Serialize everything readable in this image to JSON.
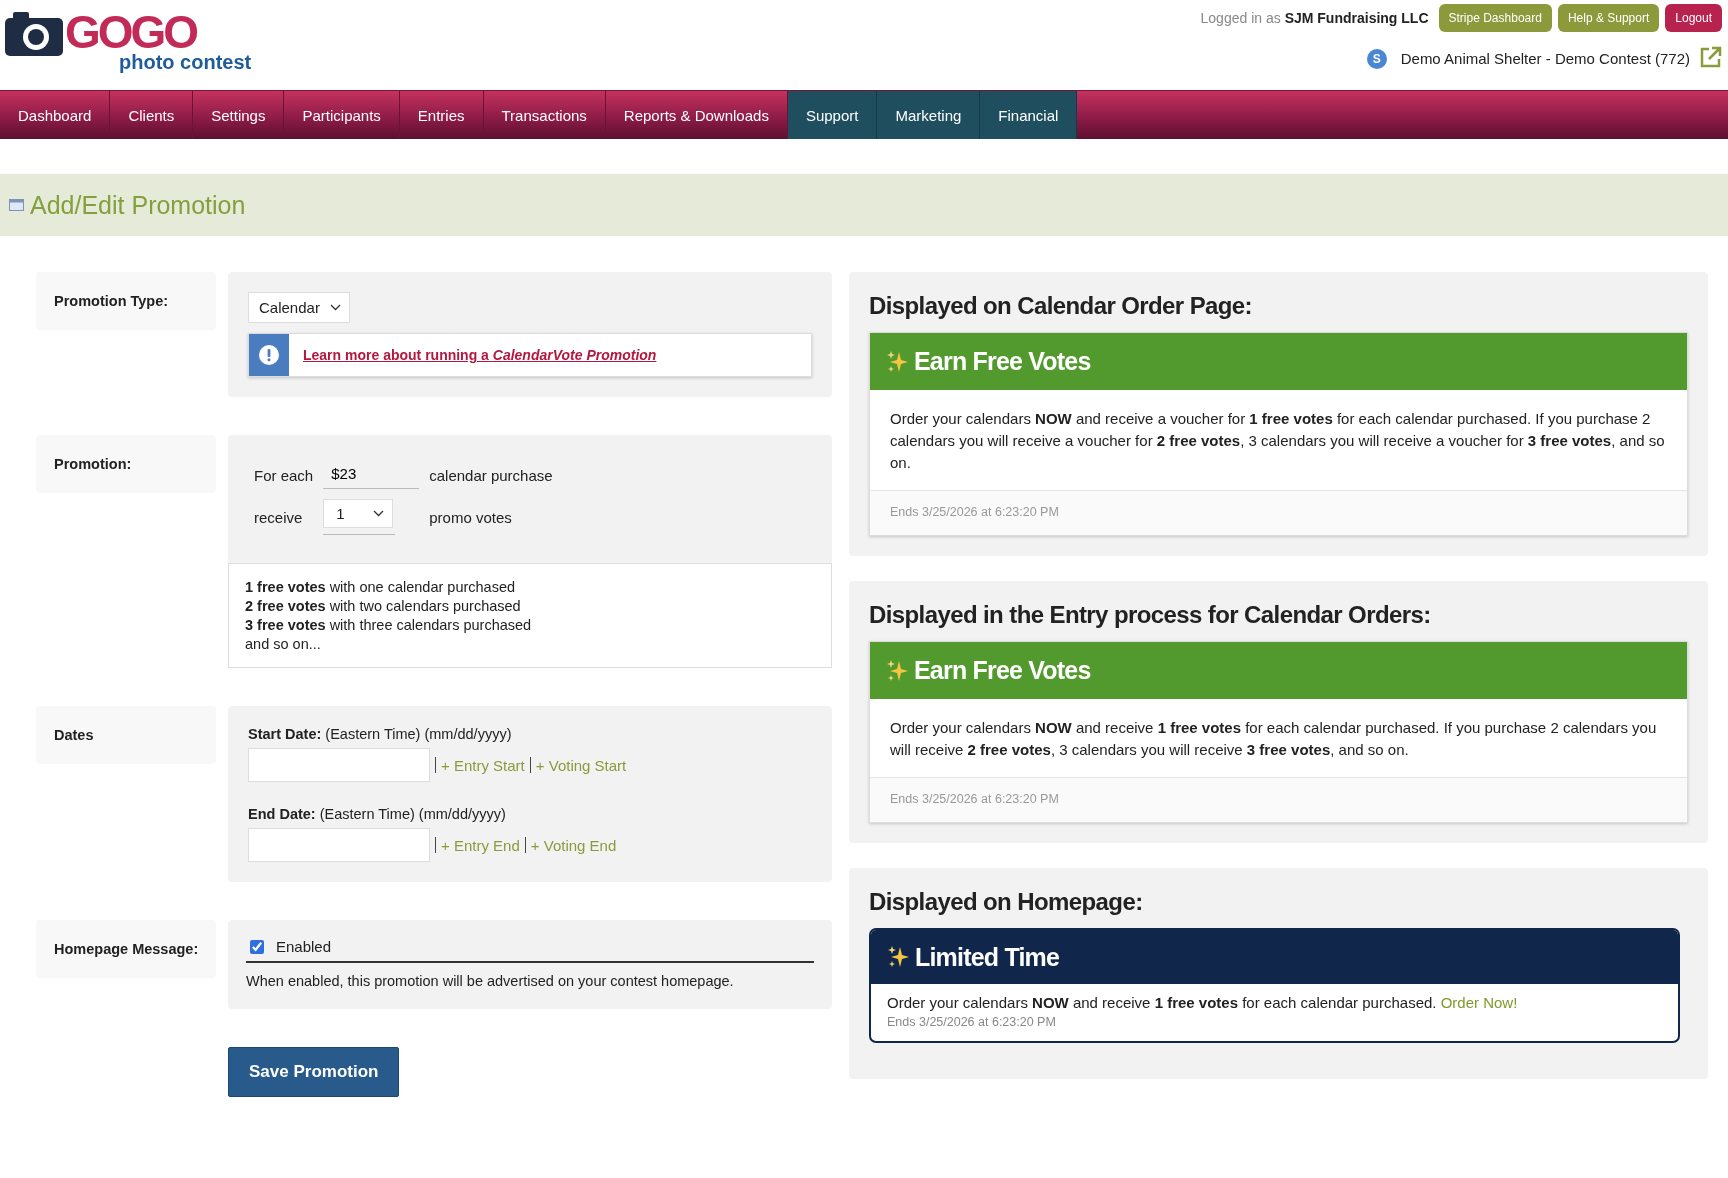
{
  "header": {
    "logo": {
      "word": "GOGO",
      "tagline": "photo contest"
    },
    "account": "Logged in as **SJM Fundraising LLC**",
    "buttons": [
      {
        "label": "Stripe Dashboard",
        "kind": "olive"
      },
      {
        "label": "Help & Support",
        "kind": "olive"
      },
      {
        "label": "Logout",
        "kind": "danger"
      }
    ],
    "contest": {
      "badge": "S",
      "name": "Demo Animal Shelter - Demo Contest (772)"
    }
  },
  "nav": [
    {
      "label": "Dashboard",
      "kind": "main"
    },
    {
      "label": "Clients",
      "kind": "main"
    },
    {
      "label": "Settings",
      "kind": "main"
    },
    {
      "label": "Participants",
      "kind": "main"
    },
    {
      "label": "Entries",
      "kind": "main"
    },
    {
      "label": "Transactions",
      "kind": "main"
    },
    {
      "label": "Reports & Downloads",
      "kind": "main"
    },
    {
      "label": "Support",
      "kind": "extra"
    },
    {
      "label": "Marketing",
      "kind": "extra"
    },
    {
      "label": "Financial",
      "kind": "extra"
    }
  ],
  "page_title": "Add/Edit Promotion",
  "form": {
    "promotion_type": {
      "label": "Promotion Type:",
      "value": "Calendar",
      "info_link": "Learn more about running a *CalendarVote Promotion*"
    },
    "promotion": {
      "label": "Promotion:",
      "for_each": "For each",
      "price": "$23",
      "price_suffix": "calendar purchase",
      "receive": "receive",
      "votes": "1",
      "votes_suffix": "promo votes",
      "examples": [
        "**1 free votes** with one calendar purchased",
        "**2 free votes** with two calendars purchased",
        "**3 free votes** with three calendars purchased",
        "and so on..."
      ]
    },
    "dates": {
      "label": "Dates",
      "fields": [
        {
          "caption": "**Start Date:** (Eastern Time) (mm/dd/yyyy)",
          "links": [
            "+ Entry Start",
            "+ Voting Start"
          ]
        },
        {
          "caption": "**End Date:** (Eastern Time) (mm/dd/yyyy)",
          "links": [
            "+ Entry End",
            "+ Voting End"
          ]
        }
      ]
    },
    "homepage": {
      "label": "Homepage Message:",
      "enabled": true,
      "option": "Enabled",
      "help": "When enabled, this promotion will be advertised on your contest homepage."
    },
    "save_button": "Save Promotion"
  },
  "previews": [
    {
      "heading": "Displayed on Calendar Order Page:",
      "kind": "card",
      "title": "Earn Free Votes",
      "body": "Order your calendars **NOW** and receive a voucher for **1 free votes** for each calendar purchased. If you purchase 2 calendars you will receive a voucher for **2 free votes**, 3 calendars you will receive a voucher for **3 free votes**, and so on.",
      "ends": "Ends 3/25/2026 at 6:23:20 PM"
    },
    {
      "heading": "Displayed in the Entry process for Calendar Orders:",
      "kind": "card",
      "title": "Earn Free Votes",
      "body": "Order your calendars **NOW** and receive **1 free votes** for each calendar purchased. If you purchase 2 calendars you will receive **2 free votes**, 3 calendars you will receive **3 free votes**, and so on.",
      "ends": "Ends 3/25/2026 at 6:23:20 PM"
    },
    {
      "heading": "Displayed on Homepage:",
      "kind": "banner",
      "title": "Limited Time",
      "body": "Order your calendars **NOW** and receive **1 free votes** for each calendar purchased.",
      "link": "Order Now!",
      "ends": "Ends 3/25/2026 at 6:23:20 PM"
    }
  ]
}
